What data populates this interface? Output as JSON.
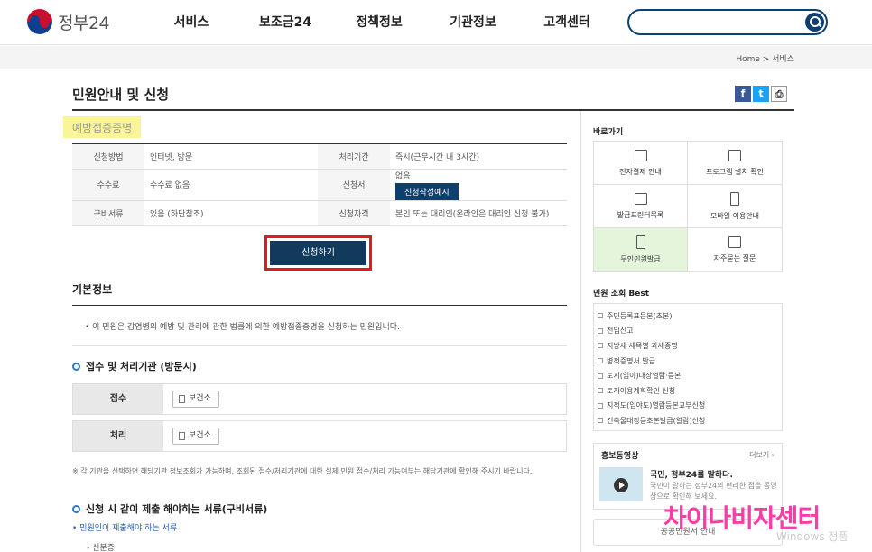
{
  "header": {
    "logo_text": "정부24",
    "menu": [
      "서비스",
      "보조금24",
      "정책정보",
      "기관정보",
      "고객센터"
    ]
  },
  "breadcrumb": "Home > 서비스",
  "page_title": "민원안내 및 신청",
  "service_name": "예방접종증명",
  "info": {
    "row1": {
      "l1": "신청방법",
      "v1": "인터넷, 방문",
      "l2": "처리기간",
      "v2": "즉시(근무시간 내 3시간)"
    },
    "row2": {
      "l1": "수수료",
      "v1": "수수료 없음",
      "l2": "신청서",
      "v2": "없음",
      "btn": "신청작성예시"
    },
    "row3": {
      "l1": "구비서류",
      "v1": "있음 (하단참조)",
      "l2": "신청자격",
      "v2": "본인 또는 대리인(온라인은 대리인 신청 불가)"
    }
  },
  "apply_button": "신청하기",
  "basic_info": {
    "title": "기본정보",
    "text": "• 이 민원은 감염병의 예방 및 관리에 관한 법률에 의한 예방접종증명을 신청하는 민원입니다."
  },
  "reception": {
    "title": "접수 및 처리기관 (방문시)",
    "rows": [
      {
        "label": "접수",
        "org": "보건소"
      },
      {
        "label": "처리",
        "org": "보건소"
      }
    ],
    "note": "※ 각 기관을 선택하면 해당기관 정보조회가 가능하며, 조회된 접수/처리기관에 대한 실제 민원 접수/처리 가능여부는 해당기관에 확인해 주시기 바랍니다."
  },
  "documents": {
    "title": "신청 시 같이 제출 해야하는 서류(구비서류)",
    "link": "• 민원인이 제출해야 하는 서류",
    "item": "- 신분증"
  },
  "sidebar": {
    "quick_title": "바로가기",
    "quick": [
      {
        "label": "전자결제 안내",
        "icon": "download-icon"
      },
      {
        "label": "프로그램 설치 확인",
        "icon": "monitor-icon"
      },
      {
        "label": "발급프린터목록",
        "icon": "printer-icon"
      },
      {
        "label": "모바일 이용안내",
        "icon": "mobile-icon"
      },
      {
        "label": "무인민원발급",
        "icon": "kiosk-icon"
      },
      {
        "label": "자주묻는 질문",
        "icon": "chat-icon"
      }
    ],
    "best_title": "민원 조회 Best",
    "best": [
      "주민등록표등본(초본)",
      "전입신고",
      "지방세 세목별 과세증명",
      "병적증명서 발급",
      "토지(임야)대장열람·등본",
      "토지이용계획확인 신청",
      "지적도(임야도)열람등본교부신청",
      "건축물대장등초본발급(열람)신청"
    ],
    "promo": {
      "title": "홍보동영상",
      "more": "더보기 ›",
      "headline": "국민, 정부24를 말하다.",
      "desc": "국민이 말하는 정부24의 편리한 점을 동영상으로 확인해 보세요."
    },
    "bottom_button": "공공민원서 안내"
  },
  "overlay_text": "차이나비자센터",
  "watermark": "Windows 정품"
}
